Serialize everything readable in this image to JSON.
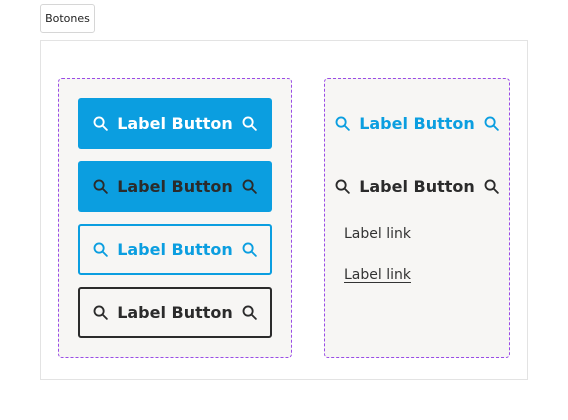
{
  "tab": {
    "label": "Botones"
  },
  "buttons_left": {
    "primary_white_label": "Label Button",
    "primary_dark_label": "Label Button",
    "outline_blue_label": "Label Button",
    "outline_dark_label": "Label Button"
  },
  "buttons_right": {
    "ghost_blue_label": "Label Button",
    "ghost_dark_label": "Label Button",
    "link_plain": "Label link",
    "link_underlined": "Label link"
  },
  "colors": {
    "accent": "#0b9ee0",
    "dark": "#2b2b2b",
    "dashed_border": "#9a4ce6",
    "group_bg": "#f7f6f4"
  },
  "icons": {
    "leading": "search-icon",
    "trailing": "search-icon"
  }
}
